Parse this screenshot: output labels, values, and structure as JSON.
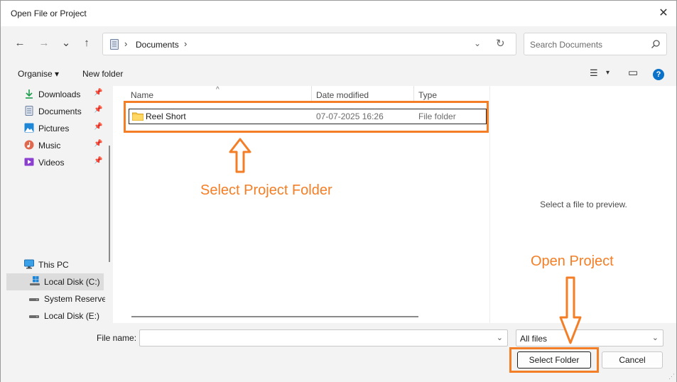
{
  "window": {
    "title": "Open File or Project",
    "close_glyph": "✕"
  },
  "nav": {
    "back": "←",
    "forward": "→",
    "recent": "⌄",
    "up": "↑"
  },
  "address": {
    "crumb_sep": "›",
    "crumb": "Documents",
    "trail_sep": "›",
    "dropdown": "⌄",
    "refresh": "↻"
  },
  "search": {
    "placeholder": "Search Documents"
  },
  "toolbar": {
    "organise": "Organise ▾",
    "new_folder": "New folder",
    "view": "☰",
    "view_dd": "▾",
    "pane": "▭",
    "help": "?"
  },
  "sidebar": {
    "quick_access": [
      {
        "label": "Downloads",
        "icon": "download-icon",
        "color": "#1b9c4a"
      },
      {
        "label": "Documents",
        "icon": "document-icon",
        "color": "#6b7f9e"
      },
      {
        "label": "Pictures",
        "icon": "picture-icon",
        "color": "#1e86d6"
      },
      {
        "label": "Music",
        "icon": "music-icon",
        "color": "#e0684d"
      },
      {
        "label": "Videos",
        "icon": "video-icon",
        "color": "#8a3fd0"
      }
    ],
    "pin_glyph": "📌",
    "this_pc": "This PC",
    "drives": [
      {
        "label": "Local Disk (C:)",
        "active": true
      },
      {
        "label": "System Reserved",
        "active": false
      },
      {
        "label": "Local Disk (E:)",
        "active": false
      }
    ]
  },
  "columns": {
    "name": "Name",
    "date": "Date modified",
    "type": "Type",
    "sort_caret": "^"
  },
  "files": [
    {
      "name": "Reel Short",
      "date": "07-07-2025 16:26",
      "type": "File folder"
    }
  ],
  "preview": {
    "text": "Select a file to preview."
  },
  "footer": {
    "file_name_label": "File name:",
    "file_name_value": "",
    "dropdown": "⌄",
    "filter": "All files",
    "select_folder": "Select Folder",
    "cancel": "Cancel",
    "grip": "⋰"
  },
  "annotations": {
    "select_project": "Select Project Folder",
    "open_project": "Open Project",
    "accent": "#f47e25"
  }
}
